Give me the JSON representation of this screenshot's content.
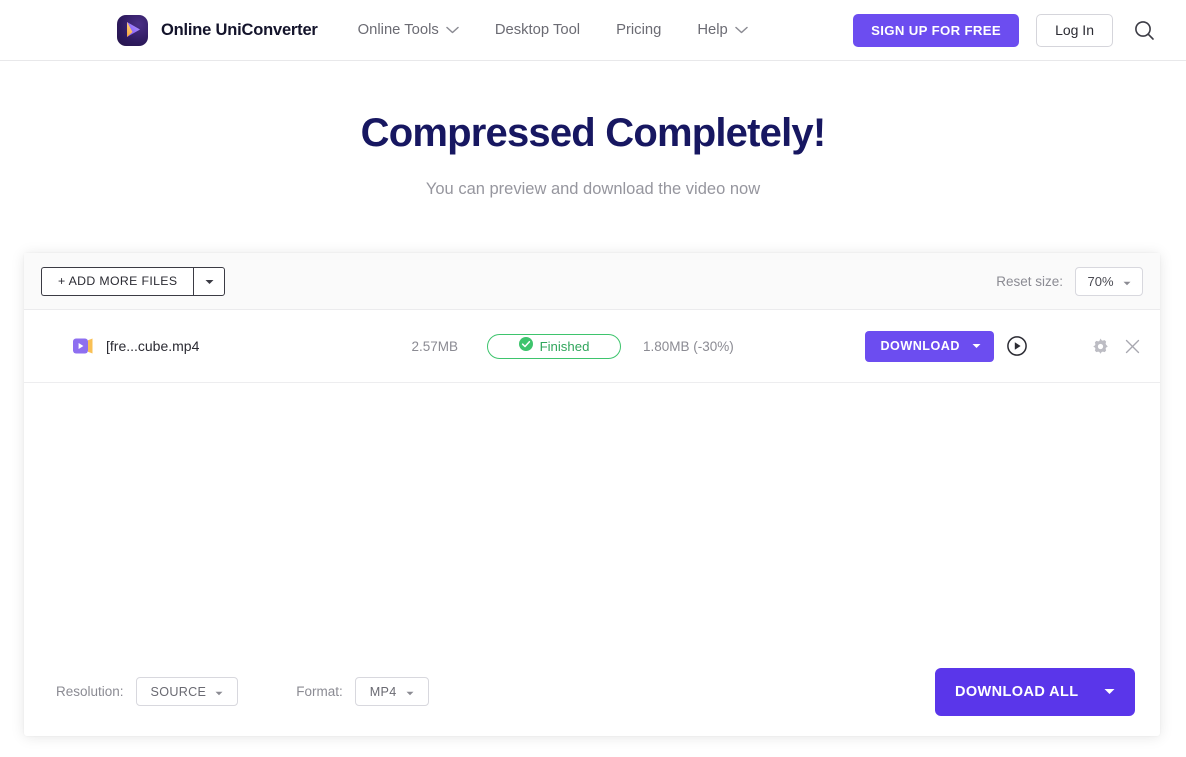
{
  "header": {
    "brand_name": "Online UniConverter",
    "logo_icon": "uniconverter-play-logo",
    "nav": [
      {
        "label": "Online Tools",
        "has_caret": true,
        "icon": "chevron-down-icon"
      },
      {
        "label": "Desktop Tool",
        "has_caret": false
      },
      {
        "label": "Pricing",
        "has_caret": false
      },
      {
        "label": "Help",
        "has_caret": true,
        "icon": "chevron-down-icon"
      }
    ],
    "signup_label": "SIGN UP FOR FREE",
    "login_label": "Log In",
    "search_icon": "search-icon"
  },
  "hero": {
    "title": "Compressed Completely!",
    "subtitle": "You can preview and download the video now"
  },
  "toolbar": {
    "add_more_label": "+ ADD MORE FILES",
    "add_more_caret_icon": "caret-down-icon",
    "reset_size_label": "Reset size:",
    "reset_size_value": "70%",
    "reset_size_caret_icon": "caret-down-icon"
  },
  "file_row": {
    "file_icon": "video-file-icon",
    "file_name": "[fre...cube.mp4",
    "original_size": "2.57MB",
    "status_icon": "check-circle-icon",
    "status_label": "Finished",
    "new_size": "1.80MB (-30%)",
    "download_label": "DOWNLOAD",
    "download_caret_icon": "caret-down-icon",
    "preview_icon": "play-circle-icon",
    "settings_icon": "gear-icon",
    "remove_icon": "close-icon"
  },
  "footer": {
    "resolution_label": "Resolution:",
    "resolution_value": "SOURCE",
    "resolution_caret_icon": "caret-down-icon",
    "format_label": "Format:",
    "format_value": "MP4",
    "format_caret_icon": "caret-down-icon",
    "download_all_label": "DOWNLOAD ALL",
    "download_all_caret_icon": "caret-down-icon"
  },
  "colors": {
    "brand_purple": "#6c4df0",
    "deep_purple": "#5a36ea",
    "title_navy": "#171761",
    "status_green": "#3ec46d",
    "muted_gray": "#8b8b93"
  }
}
